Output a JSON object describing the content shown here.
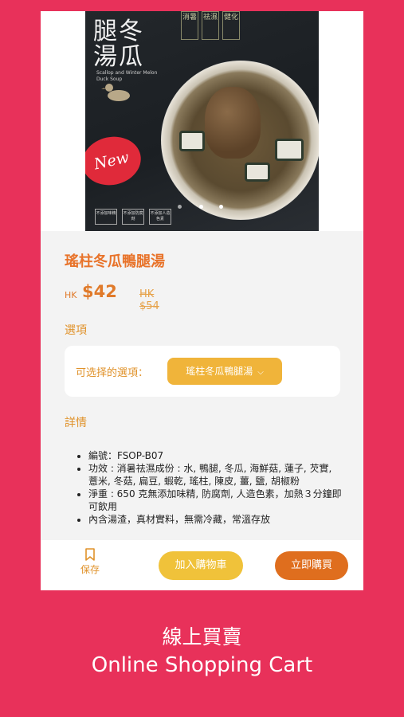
{
  "product_image": {
    "pack_title": "腿冬\n湯瓜",
    "pack_en": "Scallop and Winter Melon Duck Soup",
    "pack_stamps": [
      "消暑",
      "祛濕",
      "健化"
    ],
    "new_badge": "New",
    "pack_tags": [
      "不添加味精",
      "不添加防腐劑",
      "不添加人造色素"
    ]
  },
  "product": {
    "title": "瑤柱冬瓜鴨腿湯",
    "currency": "HK",
    "price": "$42",
    "original_price": "HK $54"
  },
  "options": {
    "section_label": "選項",
    "label": "可选择的選項：",
    "selected": "瑤柱冬瓜鴨腿湯"
  },
  "details": {
    "section_label": "詳情",
    "items": [
      "編號：FSOP-B07",
      "功效 : 消暑祛濕成份 : 水, 鴨腿, 冬瓜, 海鮮菇, 蓮子, 芡實, 薏米, 冬菇, 扁豆, 蝦乾, 瑤柱, 陳皮, 薑, 鹽, 胡椒粉",
      "淨重 : 650 克無添加味精, 防腐劑, 人造色素，加熱３分鐘即可飲用",
      "內含湯渣，真材實料，無需冷藏，常溫存放"
    ]
  },
  "bottom_bar": {
    "save_label": "保存",
    "add_to_cart": "加入購物車",
    "buy_now": "立即購買"
  },
  "caption": {
    "zh": "線上買賣",
    "en": "Online Shopping Cart"
  },
  "colors": {
    "background": "#e8315a",
    "accent_orange": "#e8732a",
    "cart_button": "#f0c23a",
    "buy_button": "#df6e1e",
    "option_select": "#f0b43a"
  }
}
